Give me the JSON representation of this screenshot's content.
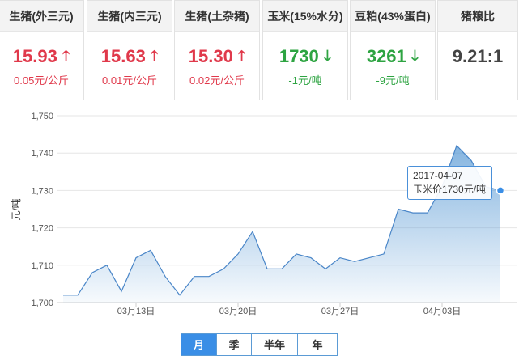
{
  "cards": [
    {
      "title": "生猪(外三元)",
      "price": "15.93",
      "trend": "up",
      "delta": "0.05元/公斤"
    },
    {
      "title": "生猪(内三元)",
      "price": "15.63",
      "trend": "up",
      "delta": "0.01元/公斤"
    },
    {
      "title": "生猪(土杂猪)",
      "price": "15.30",
      "trend": "up",
      "delta": "0.02元/公斤"
    },
    {
      "title": "玉米(15%水分)",
      "price": "1730",
      "trend": "down",
      "delta": "-1元/吨"
    },
    {
      "title": "豆粕(43%蛋白)",
      "price": "3261",
      "trend": "down",
      "delta": "-9元/吨"
    },
    {
      "title": "猪粮比",
      "price": "9.21:1",
      "trend": "none",
      "delta": ""
    }
  ],
  "colors": {
    "up": "#e0394b",
    "down": "#2ea442",
    "line": "#5b9bd5",
    "accent": "#3a8ee6"
  },
  "icons": {
    "up": "arrow-up-icon",
    "down": "arrow-down-icon"
  },
  "chart_data": {
    "type": "area",
    "ylabel": "元/吨",
    "ylim": [
      1700,
      1750
    ],
    "yticks": [
      "1,700",
      "1,710",
      "1,720",
      "1,730",
      "1,740",
      "1,750"
    ],
    "xlim": [
      "2017-03-08",
      "2017-04-07"
    ],
    "xticks": [
      {
        "date": "2017-03-13",
        "label": "03月13日"
      },
      {
        "date": "2017-03-20",
        "label": "03月20日"
      },
      {
        "date": "2017-03-27",
        "label": "03月27日"
      },
      {
        "date": "2017-04-03",
        "label": "04月03日"
      }
    ],
    "series": [
      {
        "x": [
          "2017-03-08",
          "2017-03-09",
          "2017-03-10",
          "2017-03-11",
          "2017-03-12",
          "2017-03-13",
          "2017-03-14",
          "2017-03-15",
          "2017-03-16",
          "2017-03-17",
          "2017-03-18",
          "2017-03-19",
          "2017-03-20",
          "2017-03-21",
          "2017-03-22",
          "2017-03-23",
          "2017-03-24",
          "2017-03-25",
          "2017-03-26",
          "2017-03-27",
          "2017-03-28",
          "2017-03-29",
          "2017-03-30",
          "2017-03-31",
          "2017-04-01",
          "2017-04-02",
          "2017-04-03",
          "2017-04-04",
          "2017-04-05",
          "2017-04-06",
          "2017-04-07"
        ],
        "values": [
          1702,
          1702,
          1708,
          1710,
          1703,
          1712,
          1714,
          1707,
          1702,
          1707,
          1707,
          1709,
          1713,
          1719,
          1709,
          1709,
          1713,
          1712,
          1709,
          1712,
          1711,
          1712,
          1713,
          1725,
          1724,
          1724,
          1731,
          1742,
          1738,
          1731,
          1730
        ]
      }
    ],
    "tooltip": {
      "date": "2017-04-07",
      "text": "玉米价1730元/吨"
    }
  },
  "periods": {
    "items": [
      "月",
      "季",
      "半年",
      "年"
    ],
    "active": 0
  }
}
